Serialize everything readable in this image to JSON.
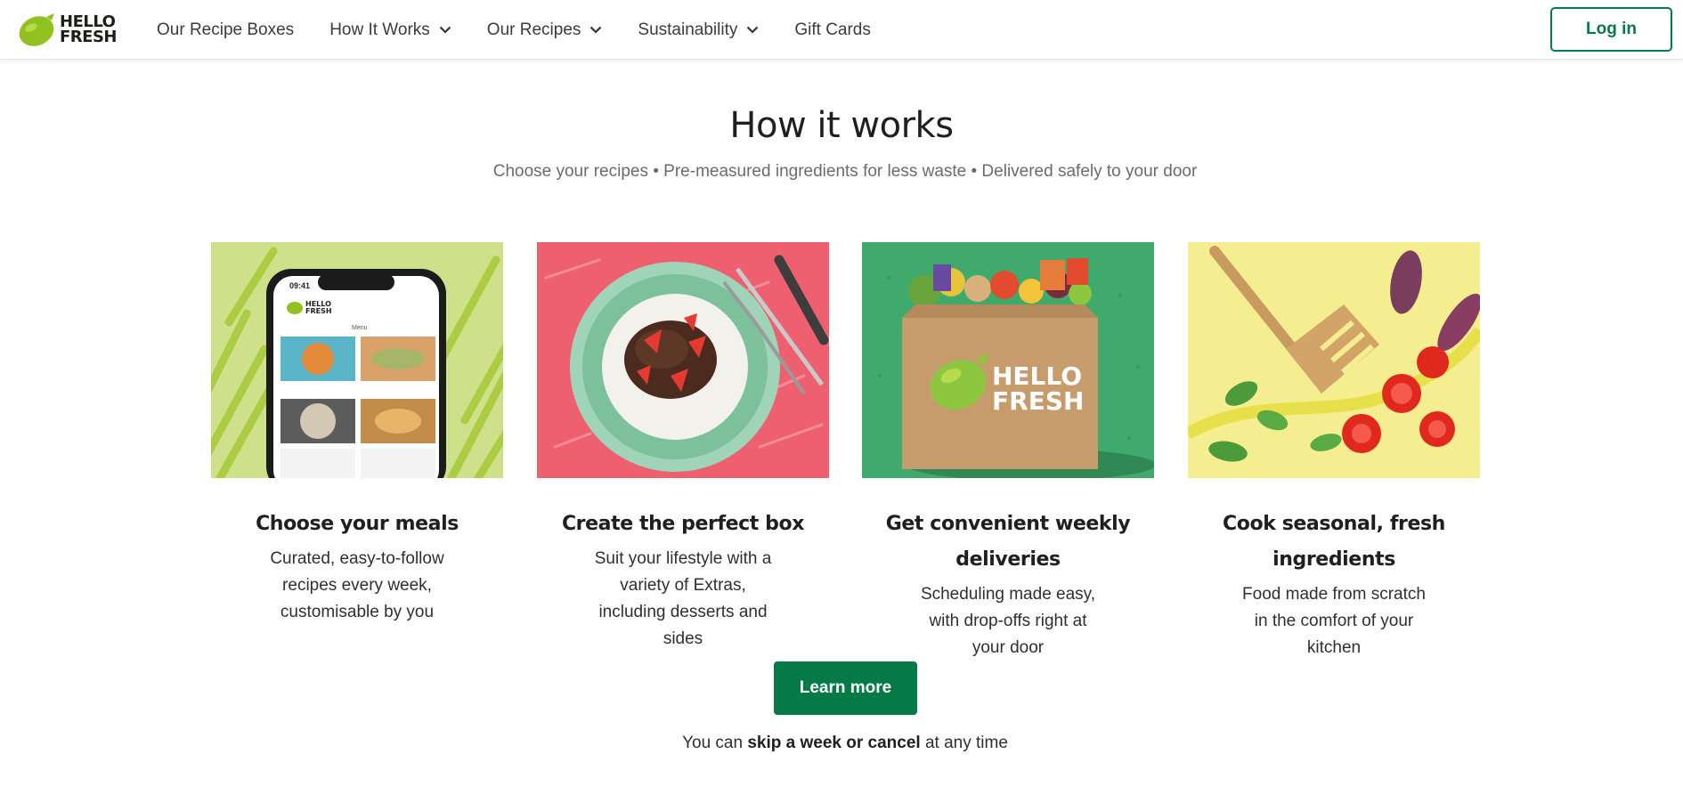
{
  "brand": {
    "logo_line1": "HELLO",
    "logo_line2": "FRESH",
    "accent_color": "#067a46",
    "lime_color": "#91c11e"
  },
  "nav": {
    "items": [
      {
        "label": "Our Recipe Boxes",
        "has_dropdown": false
      },
      {
        "label": "How It Works",
        "has_dropdown": true
      },
      {
        "label": "Our Recipes",
        "has_dropdown": true
      },
      {
        "label": "Sustainability",
        "has_dropdown": true
      },
      {
        "label": "Gift Cards",
        "has_dropdown": false
      }
    ],
    "login_label": "Log in"
  },
  "section": {
    "title": "How it works",
    "subtitle": "Choose your recipes • Pre-measured ingredients for less waste • Delivered safely to your door"
  },
  "cards": [
    {
      "title": "Choose your meals",
      "description": "Curated, easy-to-follow recipes every week, customisable by you",
      "phone_time": "09:41",
      "phone_logo_1": "HELLO",
      "phone_logo_2": "FRESH",
      "phone_menu": "Menu"
    },
    {
      "title": "Create the perfect box",
      "description": "Suit your lifestyle with a variety of Extras, including desserts and sides"
    },
    {
      "title": "Get convenient weekly deliveries",
      "description": "Scheduling made easy, with drop-offs right at your door",
      "box_logo_1": "HELLO",
      "box_logo_2": "FRESH"
    },
    {
      "title": "Cook seasonal, fresh ingredients",
      "description": "Food made from scratch in the comfort of your kitchen"
    }
  ],
  "cta": {
    "button_label": "Learn more",
    "skip_prefix": "You can ",
    "skip_bold": "skip a week or cancel",
    "skip_suffix": " at any time"
  }
}
